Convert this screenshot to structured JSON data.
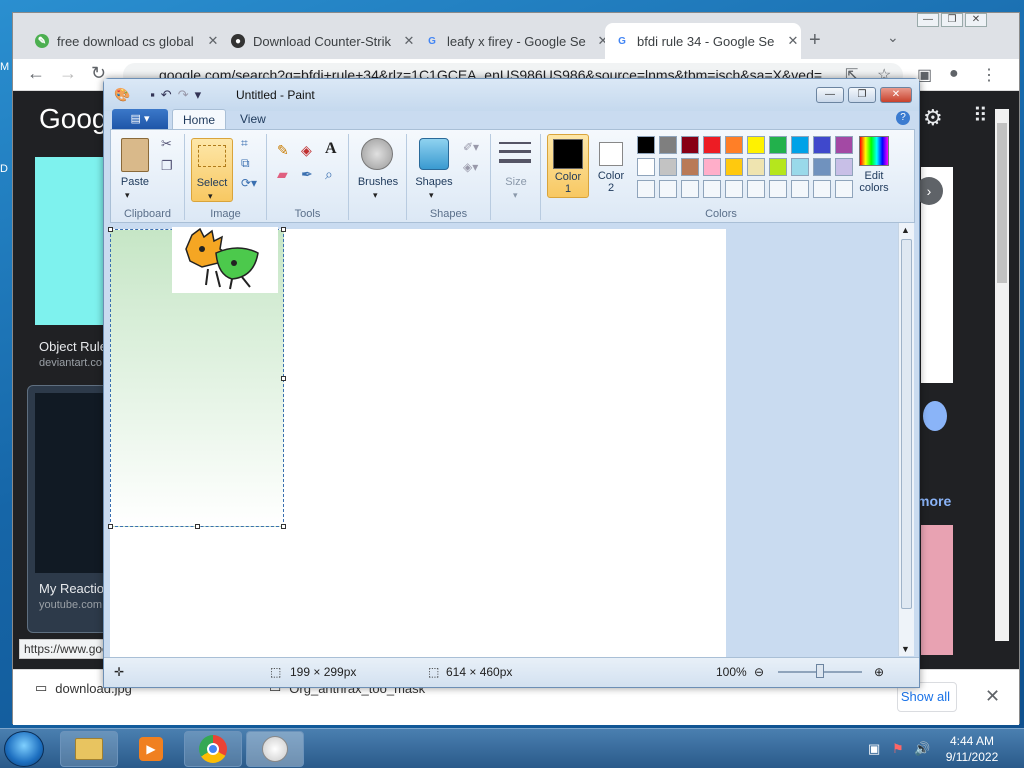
{
  "desktop": {
    "edge_m": "M",
    "edge_d": "D"
  },
  "browser": {
    "tabs": [
      {
        "title": "free download cs global",
        "favicon": "globe-icon"
      },
      {
        "title": "Download Counter-Strik",
        "favicon": "cs-icon"
      },
      {
        "title": "leafy x firey - Google Se",
        "favicon": "google-icon"
      },
      {
        "title": "bfdi rule 34 - Google Se",
        "favicon": "google-icon",
        "active": true
      }
    ],
    "new_tab": "+",
    "tab_close": "✕",
    "url": "google.com/search?q=bfdi+rule+34&rlz=1C1GCEA_enUS986US986&source=lnms&tbm=isch&sa=X&ved=...",
    "status_url": "https://www.goo",
    "page": {
      "logo": "Goog",
      "result1_title": "Object Rule",
      "result1_source": "deviantart.co",
      "result2_title": "My Reaction",
      "result2_source": "youtube.com",
      "more_text": "more",
      "next_arrow": "›"
    },
    "downloads": {
      "item1": "download.jpg",
      "item2": "Org_anthrax_too_mask",
      "show_all": "Show all",
      "close": "✕"
    }
  },
  "paint": {
    "title": "Untitled - Paint",
    "tabs": {
      "file": "▤ ▾",
      "home": "Home",
      "view": "View"
    },
    "ribbon": {
      "paste": "Paste",
      "clipboard": "Clipboard",
      "select": "Select",
      "image": "Image",
      "tools": "Tools",
      "brushes": "Brushes",
      "shapes_btn": "Shapes",
      "shapes_group": "Shapes",
      "size": "Size",
      "color1": "Color",
      "color1_num": "1",
      "color2": "Color",
      "color2_num": "2",
      "edit_colors_1": "Edit",
      "edit_colors_2": "colors",
      "colors_group": "Colors"
    },
    "palette_row1": [
      "#000000",
      "#7f7f7f",
      "#880015",
      "#ed1c24",
      "#ff7f27",
      "#fff200",
      "#22b14c",
      "#00a2e8",
      "#3f48cc",
      "#a349a4"
    ],
    "palette_row2": [
      "#ffffff",
      "#c3c3c3",
      "#b97a57",
      "#ffaec9",
      "#ffc90e",
      "#efe4b0",
      "#b5e61d",
      "#99d9ea",
      "#7092be",
      "#c8bfe7"
    ],
    "status": {
      "selection_size": "199 × 299px",
      "image_size": "614 × 460px",
      "zoom": "100%"
    }
  },
  "taskbar": {
    "clock_time": "4:44 AM",
    "clock_date": "9/11/2022"
  }
}
